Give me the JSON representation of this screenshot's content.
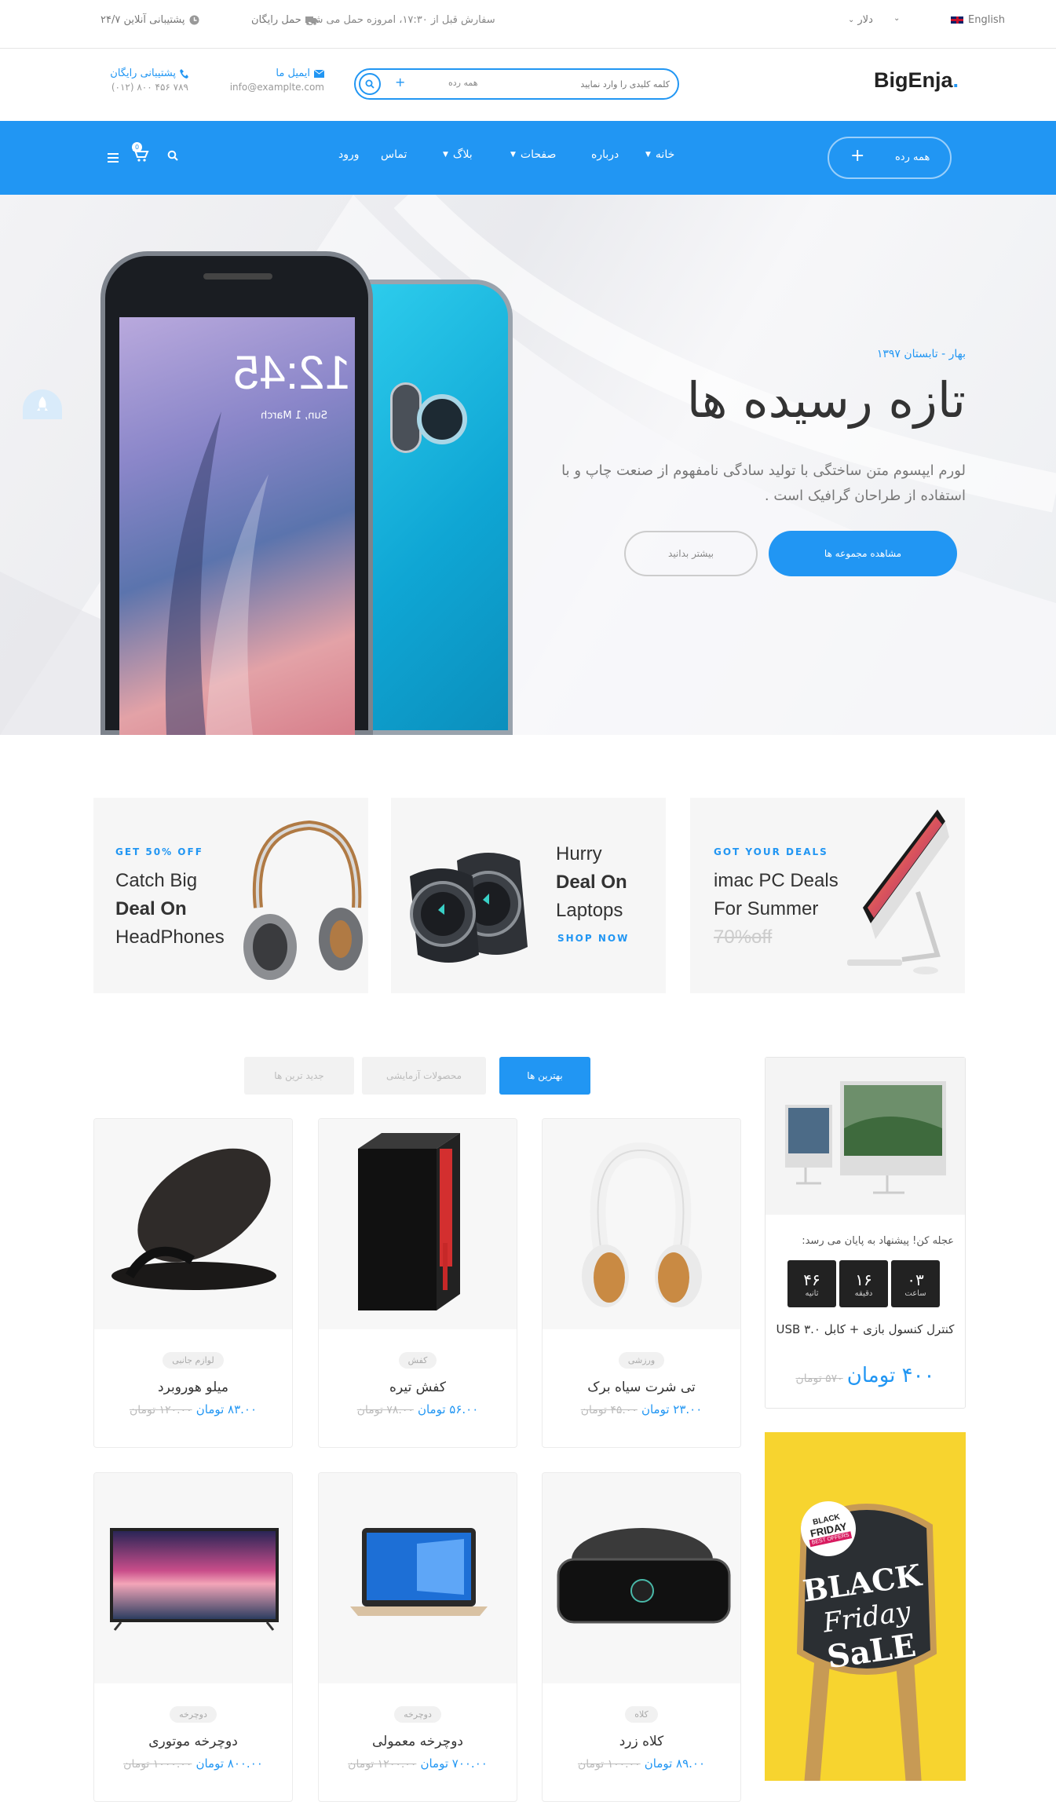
{
  "topbar": {
    "lang": "English",
    "currency": "دلار",
    "order_note": "سفارش قبل از ۱۷:۳۰، امروزه حمل می شود",
    "free_ship": "حمل رایگان",
    "support": "۲۴/۷ پشتیبانی آنلاین"
  },
  "header": {
    "logo": "BigEnja",
    "logo_dot": ".",
    "search_placeholder": "کلمه کلیدی را وارد نمایید",
    "search_category": "همه رده",
    "email_label": "ایمیل ما",
    "email_value": "info@examplte.com",
    "phone_label": "پشتیبانی رایگان",
    "phone_value": "(۰۱۲) ۸۰۰ ۴۵۶ ۷۸۹"
  },
  "nav": {
    "all_categories": "همه رده",
    "items": [
      "خانه",
      "درباره",
      "صفحات",
      "بلاگ",
      "تماس",
      "ورود"
    ],
    "cart_count": "0"
  },
  "hero": {
    "season": "بهار - تابستان ۱۳۹۷",
    "title": "تازه رسیده ها",
    "desc": "لورم ایپسوم متن ساختگی با تولید سادگی نامفهوم از صنعت چاپ و با استفاده از طراحان گرافیک است .",
    "primary_btn": "مشاهده مجموعه ها",
    "secondary_btn": "بیشتر بدانید",
    "phone_time": "12:45",
    "phone_date": "Sun, 1 March"
  },
  "promos": [
    {
      "kicker": "GOT YOUR DEALS",
      "line1": "imac PC Deals",
      "line2": "For Summer",
      "line3": "70%off"
    },
    {
      "line1": "Hurry",
      "line2": "Deal On",
      "line3": "Laptops",
      "kicker": "SHOP NOW"
    },
    {
      "kicker": "GET 50% OFF",
      "line1": "Catch Big",
      "line2": "Deal On",
      "line3": "HeadPhones"
    }
  ],
  "tabs": [
    "بهترین ها",
    "محصولات آزمایشی",
    "جدید ترین ها"
  ],
  "products": [
    {
      "tag": "ورزشی",
      "name": "تی شرت سیاه برک",
      "new": "۲۳.۰۰ تومان",
      "old": "۴۵.۰۰ تومان"
    },
    {
      "tag": "کفش",
      "name": "کفش تیره",
      "new": "۵۶.۰۰ تومان",
      "old": "۷۸.۰۰ تومان"
    },
    {
      "tag": "لوازم جانبی",
      "name": "میلو هوروبرد",
      "new": "۸۳.۰۰ تومان",
      "old": "۱۲۰.۰۰ تومان"
    },
    {
      "tag": "کلاه",
      "name": "کلاه زرد",
      "new": "۸۹.۰۰ تومان",
      "old": "۱۰۰.۰۰ تومان"
    },
    {
      "tag": "دوچرخه",
      "name": "دوچرخه معمولی",
      "new": "۷۰۰.۰۰ تومان",
      "old": "۱۲۰۰.۰۰ تومان"
    },
    {
      "tag": "دوچرخه",
      "name": "دوچرخه موتوری",
      "new": "۸۰۰.۰۰ تومان",
      "old": "۱۰۰۰.۰۰ تومان"
    }
  ],
  "deal": {
    "hurry": "عجله کن! پیشنهاد به پایان می رسد:",
    "countdown": [
      {
        "value": "۰۳",
        "label": "ساعت"
      },
      {
        "value": "۱۶",
        "label": "دقیقه"
      },
      {
        "value": "۴۶",
        "label": "ثانیه"
      }
    ],
    "name": "کنترل کنسول بازی + کابل USB ۳.۰",
    "new": "۴۰۰ تومان",
    "old": "۵۷۰ تومان"
  },
  "black_friday": {
    "badge1": "BLACK",
    "badge2": "FRIDAY",
    "badge3": "BEST OFFERS",
    "line1": "BLACK",
    "line2": "Friday",
    "line3": "SaLE"
  },
  "colors": {
    "accent": "#2196f3",
    "dark": "#222222",
    "yellow": "#f7d42f"
  }
}
